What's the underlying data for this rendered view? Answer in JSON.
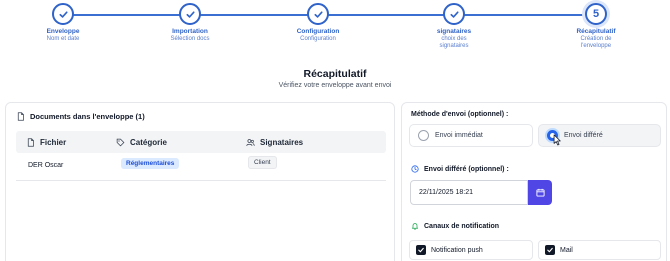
{
  "stepper": {
    "steps": [
      {
        "title": "Enveloppe",
        "sub": "Nom et date",
        "state": "done"
      },
      {
        "title": "Importation",
        "sub": "Sélection docs",
        "state": "done"
      },
      {
        "title": "Configuration",
        "sub": "Configuration",
        "state": "done"
      },
      {
        "title": "signataires",
        "sub": "choix des signataires",
        "state": "done"
      },
      {
        "title": "Récapitulatif",
        "sub": "Création de l'enveloppe",
        "state": "current",
        "number": "5"
      }
    ]
  },
  "heading": {
    "title": "Récapitulatif",
    "subtitle": "Vérifiez votre enveloppe avant envoi"
  },
  "documents": {
    "header": "Documents dans l'enveloppe (1)",
    "columns": {
      "file": "Fichier",
      "category": "Catégorie",
      "signers": "Signataires"
    },
    "rows": [
      {
        "file": "DER Oscar",
        "category": "Réglementaires",
        "signer": "Client"
      }
    ]
  },
  "send": {
    "method_label": "Méthode d'envoi (optionnel) :",
    "option_immediate": "Envoi immédiat",
    "option_deferred": "Envoi différé",
    "selected": "Envoi différé",
    "deferred_label": "Envoi différé (optionnel) :",
    "deferred_value": "22/11/2025 18:21",
    "channels_label": "Canaux de notification",
    "channel_push": "Notification push",
    "channel_mail": "Mail"
  },
  "colors": {
    "accent": "#2f63c9",
    "calendar_button": "#4f46e5",
    "category_badge_bg": "#dbeafe"
  },
  "icons": {
    "check": "check-icon",
    "document": "document-icon",
    "tag": "tag-icon",
    "users": "users-icon",
    "clock": "clock-icon",
    "calendar": "calendar-icon",
    "bell": "bell-icon"
  }
}
